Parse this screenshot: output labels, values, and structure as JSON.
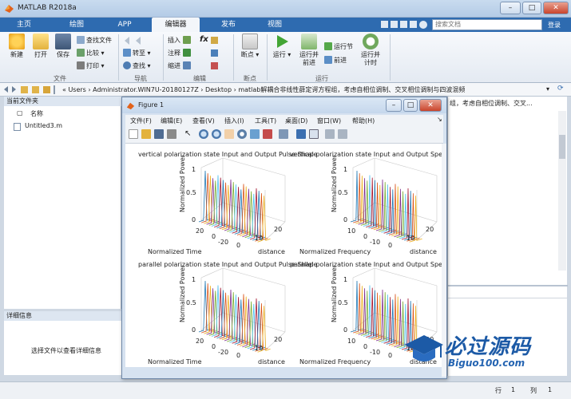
{
  "window": {
    "title": "MATLAB R2018a",
    "min": "–",
    "max": "□",
    "close": "✕"
  },
  "ribbon_tabs": [
    {
      "label": "主页"
    },
    {
      "label": "绘图"
    },
    {
      "label": "APP"
    },
    {
      "label": "编辑器",
      "active": true
    },
    {
      "label": "发布"
    },
    {
      "label": "视图"
    }
  ],
  "search_placeholder": "搜索文档",
  "login_label": "登录",
  "ribbon": {
    "file": {
      "section": "文件",
      "new": "新建",
      "open": "打开",
      "save": "保存",
      "find_files": "查找文件",
      "compare": "比较",
      "print": "打印"
    },
    "nav": {
      "section": "导航",
      "goto": "转至",
      "find": "查找"
    },
    "edit": {
      "section": "编辑",
      "insert": "插入",
      "comment": "注释",
      "indent": "缩进",
      "fx": "fx"
    },
    "breakpoints": {
      "section": "断点",
      "label": "断点"
    },
    "run": {
      "section": "运行",
      "run": "运行",
      "run_advance": "运行并\n前进",
      "run_section": "运行节",
      "advance": "前进",
      "run_time": "运行并\n计时"
    }
  },
  "address": {
    "text": "« Users › Administrator.WIN7U-20180127Z › Desktop › matlab解耦合非线性薛定谔方程组，考虑自相位调制、交叉相位调制与四波混频"
  },
  "current_folder": {
    "header": "当前文件夹",
    "column": "名称",
    "files": [
      {
        "name": "Untitled3.m"
      }
    ]
  },
  "details": {
    "header": "详细信息",
    "hint": "选择文件以查看详细信息"
  },
  "editor_tail": "组，考虑自相位调制、交叉...",
  "statusbar": {
    "row_label": "行",
    "row_value": "1",
    "col_label": "列",
    "col_value": "1"
  },
  "figure": {
    "title": "Figure 1",
    "menus": [
      "文件(F)",
      "编辑(E)",
      "查看(V)",
      "插入(I)",
      "工具(T)",
      "桌面(D)",
      "窗口(W)",
      "帮助(H)"
    ],
    "plots": [
      {
        "title": "vertical polarization state Input and Output Pulse Shape",
        "zlabel": "Normalized Power",
        "xlabel": "Normalized Time",
        "ylabel": "distance",
        "zticks": [
          "1",
          "0.5",
          "0"
        ],
        "xticks": [
          "20",
          "0",
          "-20"
        ],
        "yticks": [
          "0",
          "10",
          "20"
        ]
      },
      {
        "title": "vertical polarization state Input and Output Spectrum",
        "zlabel": "Normalized Power",
        "xlabel": "Normalized Frequency",
        "ylabel": "distance",
        "zticks": [
          "1",
          "0.5",
          "0"
        ],
        "xticks": [
          "10",
          "0",
          "-10"
        ],
        "yticks": [
          "0",
          "10",
          "20"
        ]
      },
      {
        "title": "parallel polarization state Input and Output Pulse Shape",
        "zlabel": "Normalized Power",
        "xlabel": "Normalized Time",
        "ylabel": "distance",
        "zticks": [
          "1",
          "0.5",
          "0"
        ],
        "xticks": [
          "20",
          "0",
          "-20"
        ],
        "yticks": [
          "0",
          "10",
          "20"
        ]
      },
      {
        "title": "parallel polarization state Input and Output Spectrum",
        "zlabel": "Normalized Power",
        "xlabel": "Normalized Frequency",
        "ylabel": "distance",
        "zticks": [
          "1",
          "0.5",
          "0"
        ],
        "xticks": [
          "10",
          "0",
          "-10"
        ],
        "yticks": [
          "0",
          "10",
          "20"
        ]
      }
    ]
  },
  "watermark": {
    "title": "必过源码",
    "url": "Biguo100.com"
  },
  "colors": {
    "ribbon_tab_bg": "#2e6bb0",
    "line_colors": [
      "#1f77b4",
      "#d95319",
      "#edb120",
      "#7e2f8e",
      "#77ac30",
      "#4dbeee",
      "#a2142f"
    ]
  }
}
